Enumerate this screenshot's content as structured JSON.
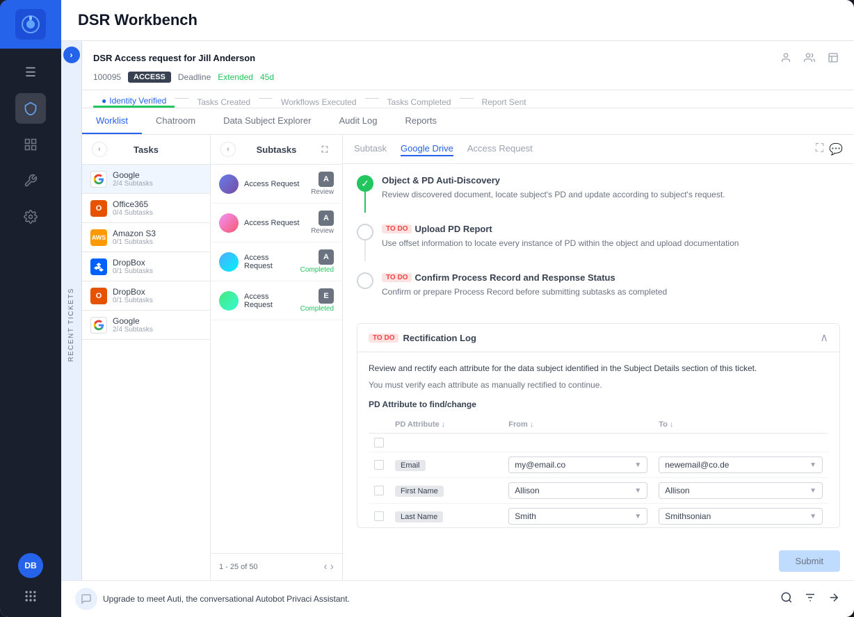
{
  "app": {
    "title": "DSR Workbench",
    "logo": "securiti"
  },
  "sidebar": {
    "menu_icon": "☰",
    "icons": [
      {
        "name": "shield-icon",
        "symbol": "🛡",
        "active": true
      },
      {
        "name": "dashboard-icon",
        "symbol": "⊞"
      },
      {
        "name": "wrench-icon",
        "symbol": "🔧"
      },
      {
        "name": "settings-icon",
        "symbol": "⚙"
      }
    ],
    "avatar": "DB",
    "dots": "⋯"
  },
  "ticket": {
    "title": "DSR Access request for Jill Anderson",
    "id": "100095",
    "type": "ACCESS",
    "deadline_label": "Deadline",
    "deadline_status": "Extended",
    "deadline_days": "45d"
  },
  "progress_tabs": [
    {
      "label": "Identity Verified",
      "active": true
    },
    {
      "label": "Tasks Created",
      "active": false
    },
    {
      "label": "Workflows Executed",
      "active": false
    },
    {
      "label": "Tasks Completed",
      "active": false
    },
    {
      "label": "Report Sent",
      "active": false
    }
  ],
  "view_tabs": [
    {
      "label": "Worklist",
      "active": true
    },
    {
      "label": "Chatroom",
      "active": false
    },
    {
      "label": "Data Subject Explorer",
      "active": false
    },
    {
      "label": "Audit Log",
      "active": false
    },
    {
      "label": "Reports",
      "active": false
    }
  ],
  "tasks": {
    "header": "Tasks",
    "items": [
      {
        "name": "Google",
        "subtasks": "2/4 Subtasks",
        "active": true,
        "type": "google"
      },
      {
        "name": "Office365",
        "subtasks": "0/4 Subtasks",
        "active": false,
        "type": "office"
      },
      {
        "name": "Amazon S3",
        "subtasks": "0/1 Subtasks",
        "active": false,
        "type": "aws"
      },
      {
        "name": "DropBox",
        "subtasks": "0/1 Subtasks",
        "active": false,
        "type": "dropbox"
      },
      {
        "name": "DropBox",
        "subtasks": "0/1 Subtasks",
        "active": false,
        "type": "dropbox"
      },
      {
        "name": "Google",
        "subtasks": "2/4 Subtasks",
        "active": false,
        "type": "google"
      }
    ]
  },
  "subtasks": {
    "header": "Subtasks",
    "items": [
      {
        "name": "Access Request",
        "badge": "A",
        "status": "Review"
      },
      {
        "name": "Access Request",
        "badge": "A",
        "status": "Review"
      },
      {
        "name": "Access Request",
        "badge": "A",
        "status": "Completed"
      },
      {
        "name": "Access Request",
        "badge": "E",
        "status": "Completed"
      }
    ],
    "pagination": "1 - 25 of 50"
  },
  "detail": {
    "tabs": [
      {
        "label": "Subtask",
        "active": false
      },
      {
        "label": "Google Drive",
        "active": true
      },
      {
        "label": "Access Request",
        "active": false
      }
    ],
    "task_items": [
      {
        "id": "task1",
        "done": true,
        "title": "Object & PD Auti-Discovery",
        "description": "Review discovered document, locate subject's PD and update according to subject's request."
      },
      {
        "id": "task2",
        "done": false,
        "todo": true,
        "title": "Upload PD Report",
        "description": "Use offset information to locate every instance of PD within the object and upload documentation"
      },
      {
        "id": "task3",
        "done": false,
        "todo": true,
        "title": "Confirm Process Record and Response Status",
        "description": "Confirm or prepare Process Record before submitting subtasks as completed"
      }
    ],
    "rectification": {
      "title": "Rectification Log",
      "description": "Review and rectify each attribute for the data subject identified in the Subject Details section of this ticket.",
      "note": "You must verify each attribute as manually rectified to continue.",
      "pd_table_title": "PD Attribute to find/change",
      "columns": [
        "",
        "PD Attribute ↓",
        "From ↓",
        "To ↓"
      ],
      "rows": [
        {
          "attr": "Email",
          "from": "my@email.co",
          "to": "newemail@co.de"
        },
        {
          "attr": "First Name",
          "from": "Allison",
          "to": "Allison"
        },
        {
          "attr": "Last Name",
          "from": "Smith",
          "to": "Smithsonian"
        }
      ]
    },
    "submit_label": "Submit"
  },
  "recent_tickets": "RECENT TICKETS",
  "bottom_bar": {
    "upgrade_text": "Upgrade to meet Auti, the conversational Autobot Privaci Assistant.",
    "search_icon": "🔍",
    "filter_icon": "≡",
    "arrow_icon": "➤"
  }
}
